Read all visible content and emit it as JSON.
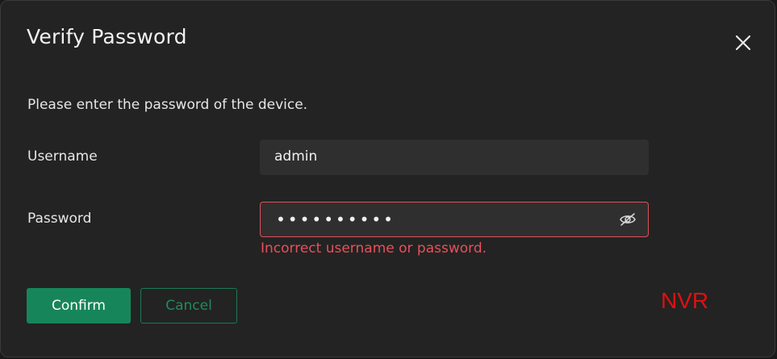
{
  "dialog": {
    "title": "Verify Password",
    "description": "Please enter the password of the device."
  },
  "form": {
    "username_label": "Username",
    "username_value": "admin",
    "password_label": "Password",
    "password_value": "••••••••••",
    "error_message": "Incorrect username or password."
  },
  "buttons": {
    "confirm_label": "Confirm",
    "cancel_label": "Cancel"
  },
  "watermark": "NVR",
  "icons": {
    "close": "close-icon",
    "password_visibility": "eye-off-icon"
  },
  "colors": {
    "accent": "#17855a",
    "error": "#e8505a",
    "watermark": "#e01010"
  }
}
